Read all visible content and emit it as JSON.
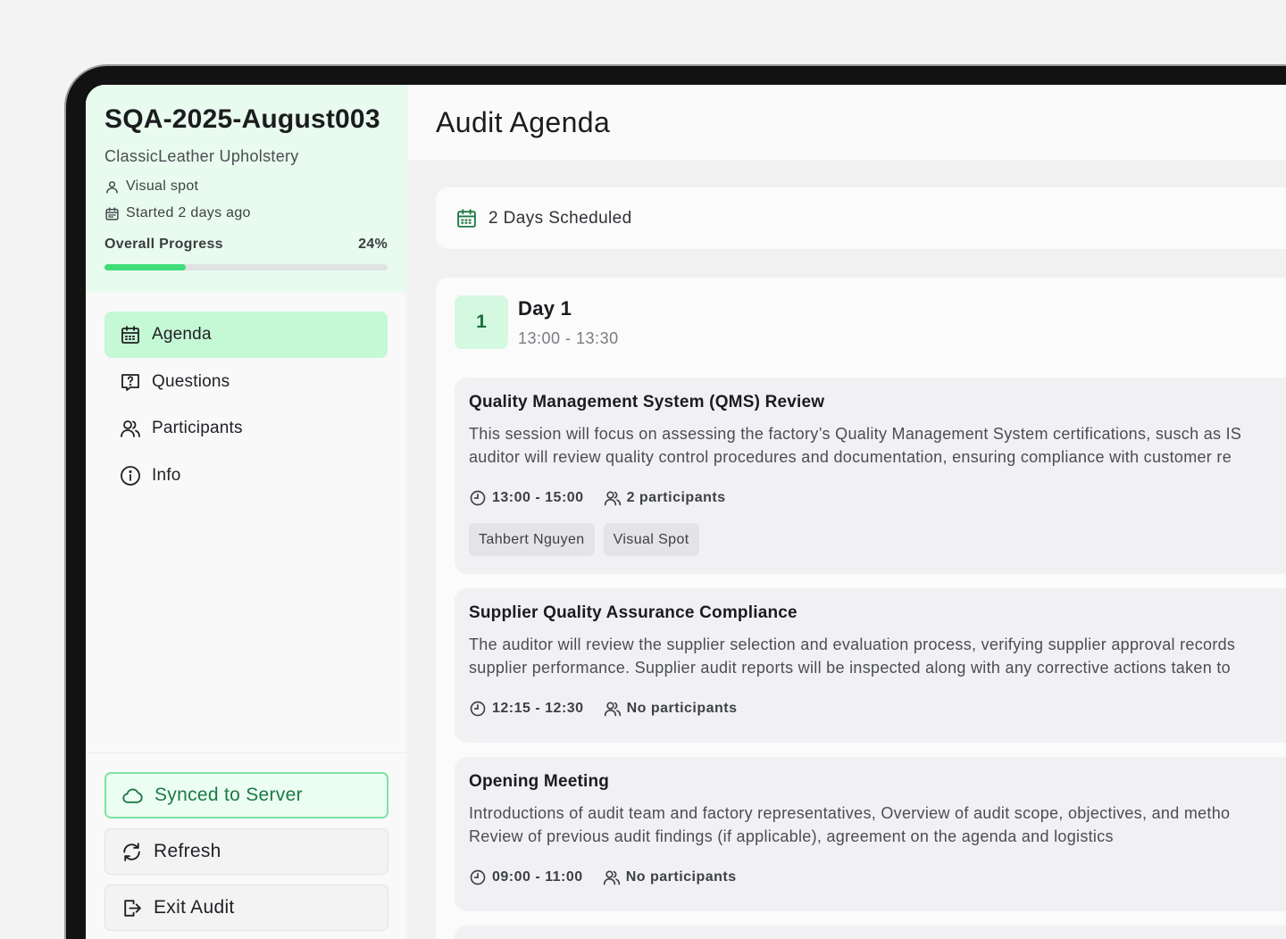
{
  "sidebar": {
    "audit_id": "SQA-2025-August003",
    "company": "ClassicLeather Upholstery",
    "audit_type": "Visual spot",
    "started": "Started 2 days ago",
    "progress_label": "Overall Progress",
    "progress_text": "24%",
    "progress_value": 0.24,
    "nav": [
      {
        "label": "Agenda",
        "active": true
      },
      {
        "label": "Questions"
      },
      {
        "label": "Participants"
      },
      {
        "label": "Info"
      }
    ],
    "footer": {
      "synced": "Synced to Server",
      "refresh": "Refresh",
      "exit": "Exit Audit"
    }
  },
  "main": {
    "title": "Audit Agenda",
    "scheduled": "2 Days Scheduled",
    "day": {
      "number": "1",
      "label": "Day 1",
      "time": "13:00 - 13:30"
    },
    "sessions": [
      {
        "title": "Quality Management System (QMS) Review",
        "desc_line1": "This session will focus on assessing the factory’s Quality Management System certifications, susch as IS",
        "desc_line2": "auditor will review quality control procedures and documentation, ensuring compliance with customer re",
        "time": "13:00 - 15:00",
        "participants": "2 participants",
        "tags": [
          "Tahbert Nguyen",
          "Visual Spot"
        ]
      },
      {
        "title": "Supplier Quality Assurance Compliance",
        "desc_line1": "The auditor will review the supplier selection and evaluation process, verifying supplier approval records",
        "desc_line2": "supplier performance. Supplier audit reports will be inspected along with any corrective actions taken to",
        "time": "12:15 - 12:30",
        "participants": "No participants"
      },
      {
        "title": "Opening Meeting",
        "desc_line1": "Introductions of audit team and factory representatives, Overview of audit scope, objectives, and metho",
        "desc_line2": "Review of previous audit findings (if applicable), agreement on the agenda and logistics",
        "time": "09:00 - 11:00",
        "participants": "No participants"
      }
    ]
  },
  "colors": {
    "accent": "#3fdc79",
    "accent_bg": "#c5f8d5",
    "header_bg": "#e8fbee",
    "synced_text": "#1b7a44"
  }
}
